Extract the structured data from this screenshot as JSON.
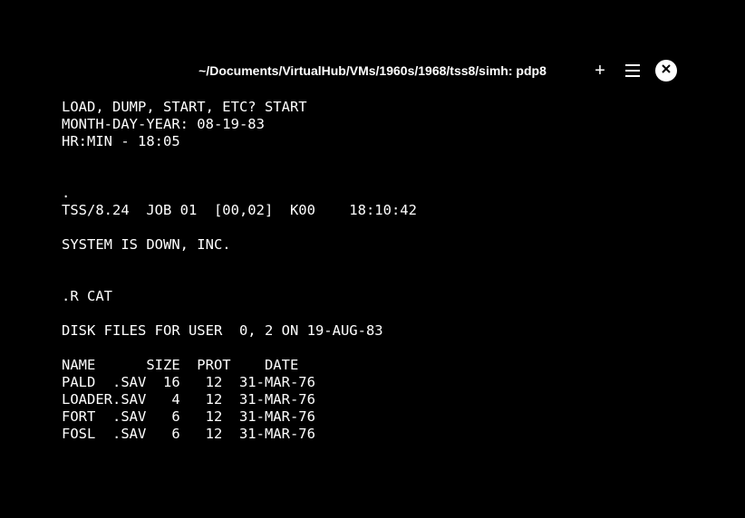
{
  "window": {
    "title": "~/Documents/VirtualHub/VMs/1960s/1968/tss8/simh: pdp8"
  },
  "terminal": {
    "lines": [
      "LOAD, DUMP, START, ETC? START",
      "MONTH-DAY-YEAR: 08-19-83",
      "HR:MIN - 18:05",
      "",
      "",
      ".",
      "TSS/8.24  JOB 01  [00,02]  K00    18:10:42",
      "",
      "SYSTEM IS DOWN, INC.",
      "",
      "",
      ".R CAT",
      "",
      "DISK FILES FOR USER  0, 2 ON 19-AUG-83",
      "",
      "NAME      SIZE  PROT    DATE",
      "PALD  .SAV  16   12  31-MAR-76",
      "LOADER.SAV   4   12  31-MAR-76",
      "FORT  .SAV   6   12  31-MAR-76",
      "FOSL  .SAV   6   12  31-MAR-76"
    ]
  }
}
